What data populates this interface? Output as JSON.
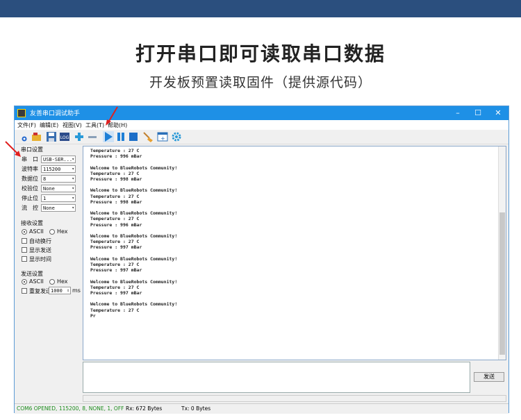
{
  "headline": "打开串口即可读取串口数据",
  "subline": "开发板预置读取固件（提供源代码）",
  "window": {
    "title": "友善串口调试助手",
    "controls": [
      "–",
      "☐",
      "✕"
    ]
  },
  "menu": [
    "文件(F)",
    "编辑(E)",
    "视图(V)",
    "工具(T)",
    "帮助(H)"
  ],
  "toolbar_icons": [
    "new-icon",
    "open-icon",
    "save-icon",
    "log-icon",
    "plus-icon",
    "minus-icon",
    "play-icon",
    "pause-icon",
    "stop-icon",
    "clear-icon",
    "add-window-icon",
    "settings-icon"
  ],
  "serial_settings": {
    "title": "串口设置",
    "port": {
      "label": "串　口",
      "value": "USB-SER..."
    },
    "baud": {
      "label": "波特率",
      "value": "115200"
    },
    "databits": {
      "label": "数据位",
      "value": "8"
    },
    "parity": {
      "label": "校验位",
      "value": "None"
    },
    "stopbits": {
      "label": "停止位",
      "value": "1"
    },
    "flow": {
      "label": "流　控",
      "value": "None"
    }
  },
  "recv_settings": {
    "title": "接收设置",
    "ascii": "ASCII",
    "hex": "Hex",
    "auto_wrap": "自动换行",
    "show_send": "显示发送",
    "show_time": "显示时间"
  },
  "send_settings": {
    "title": "发送设置",
    "ascii": "ASCII",
    "hex": "Hex",
    "repeat": "重复发送",
    "interval": "1000",
    "unit": "ms"
  },
  "receive_text": "Temperature : 27 C\nPressure : 996 mBar\n\nWelcome to BlueRobots Community!\nTemperature : 27 C\nPressure : 998 mBar\n\nWelcome to BlueRobots Community!\nTemperature : 27 C\nPressure : 998 mBar\n\nWelcome to BlueRobots Community!\nTemperature : 27 C\nPressure : 996 mBar\n\nWelcome to BlueRobots Community!\nTemperature : 27 C\nPressure : 997 mBar\n\nWelcome to BlueRobots Community!\nTemperature : 27 C\nPressure : 997 mBar\n\nWelcome to BlueRobots Community!\nTemperature : 27 C\nPressure : 997 mBar\n\nWelcome to BlueRobots Community!\nTemperature : 27 C\nPr",
  "send_button": "发送",
  "status": {
    "port": "COM6 OPENED, 115200, 8, NONE, 1, OFF",
    "rx": "Rx: 672 Bytes",
    "tx": "Tx: 0 Bytes"
  },
  "colors": {
    "topbar": "#2b4f7e",
    "titlebar": "#1e90e6",
    "arrow": "#e02020",
    "status_green": "#1a8a1a"
  }
}
